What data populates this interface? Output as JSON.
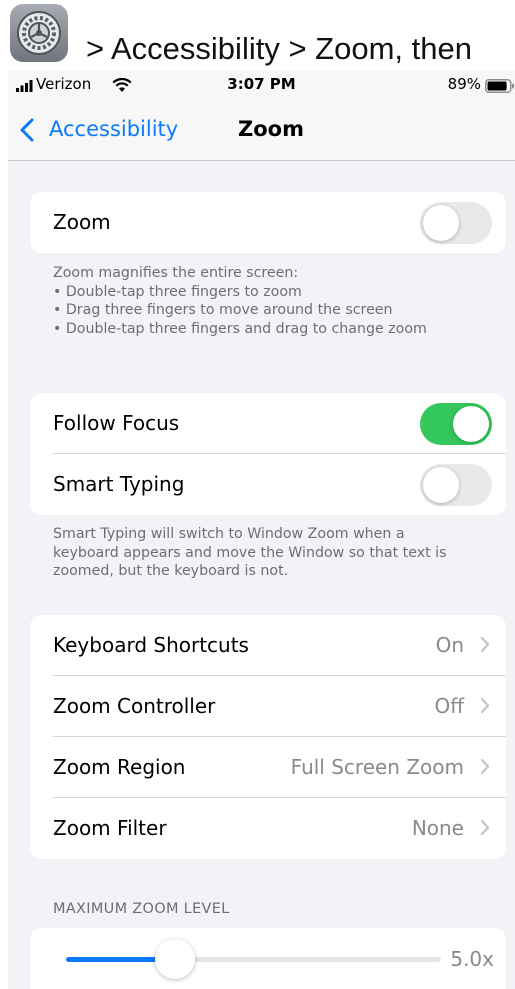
{
  "instruction": {
    "app_icon": "settings-gear-icon",
    "text": "> Accessibility > Zoom, then"
  },
  "status_bar": {
    "carrier": "Verizon",
    "time": "3:07 PM",
    "battery": "89%",
    "battery_level": 0.89
  },
  "nav": {
    "back_label": "Accessibility",
    "title": "Zoom"
  },
  "zoom_group": {
    "label": "Zoom",
    "enabled": false
  },
  "zoom_footer": {
    "lines": [
      "Zoom magnifies the entire screen:",
      "•  Double-tap three fingers to zoom",
      "•  Drag three fingers to move around the screen",
      "•  Double-tap three fingers and drag to change zoom"
    ]
  },
  "focus_group": {
    "follow_focus": {
      "label": "Follow Focus",
      "enabled": true
    },
    "smart_typing": {
      "label": "Smart Typing",
      "enabled": false
    }
  },
  "smart_typing_footer": {
    "lines": [
      "Smart Typing will switch to Window Zoom when a",
      "keyboard appears and move the Window so that text is",
      "zoomed, but the keyboard is not."
    ]
  },
  "options_group": {
    "rows": [
      {
        "label": "Keyboard Shortcuts",
        "value": "On"
      },
      {
        "label": "Zoom Controller",
        "value": "Off"
      },
      {
        "label": "Zoom Region",
        "value": "Full Screen Zoom"
      },
      {
        "label": "Zoom Filter",
        "value": "None"
      }
    ]
  },
  "max_zoom": {
    "header": "MAXIMUM ZOOM LEVEL",
    "value_label": "5.0x",
    "slider_fraction": 0.29
  },
  "colors": {
    "accent": "#0a7aff",
    "toggle_on": "#34c759",
    "toggle_off": "#e9e9eb",
    "background": "#f2f2f7"
  }
}
